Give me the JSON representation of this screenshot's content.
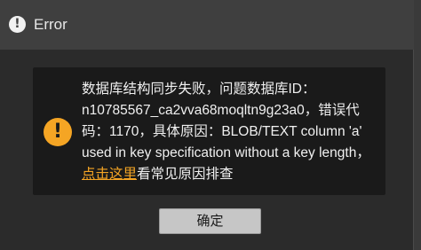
{
  "dialog": {
    "title": "Error",
    "title_icon": "exclamation-circle-icon",
    "message_icon": "warning-circle-icon",
    "message_text": "数据库结构同步失败，问题数据库ID：n10785567_ca2vva68moqltn9g23a0，错误代码：1170，具体原因：BLOB/TEXT column 'a' used in key specification without a key length，",
    "message_link": "点击这里",
    "message_suffix": "看常见原因排查",
    "ok_label": "确定"
  },
  "colors": {
    "titlebar": "#3f3f3f",
    "dialog_bg": "#2b2b2b",
    "message_bg": "#1a1a1a",
    "accent": "#f5a524",
    "button_bg": "#c6c6c6"
  }
}
